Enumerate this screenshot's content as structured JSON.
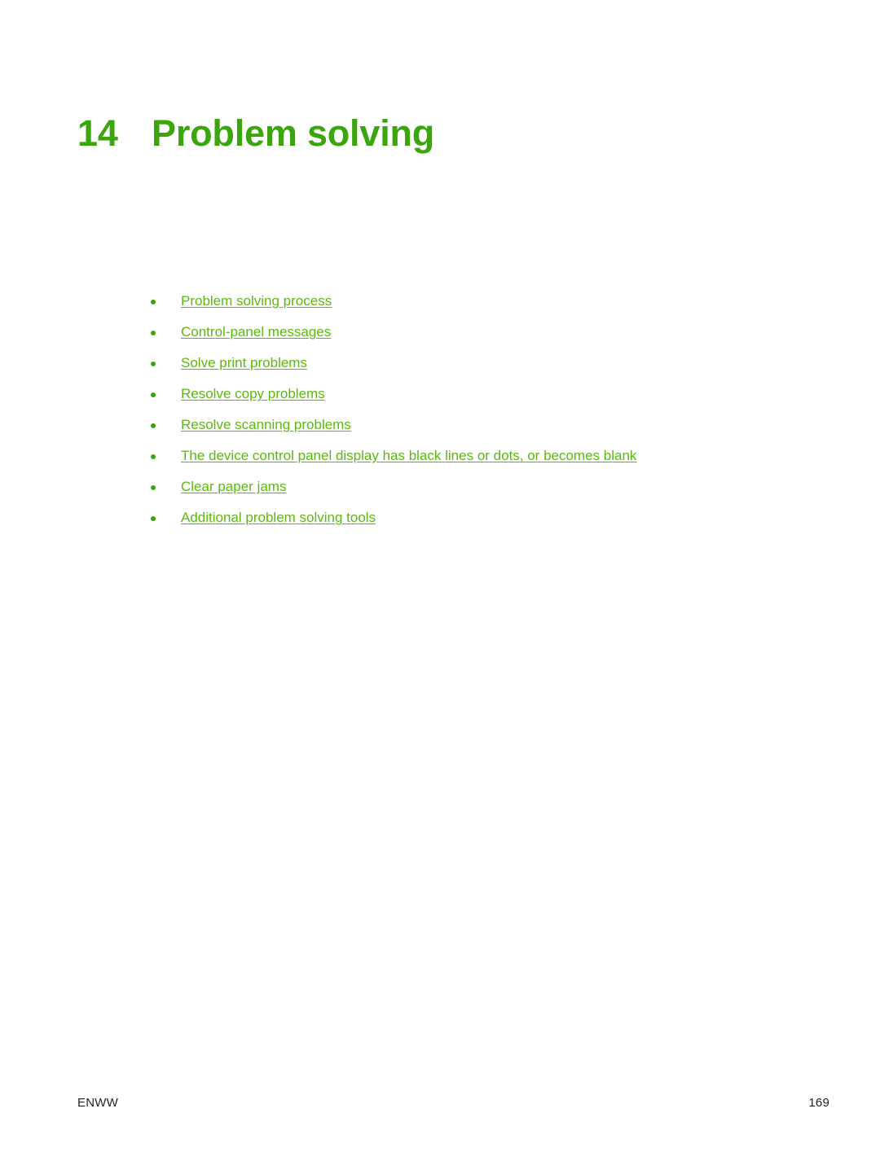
{
  "document": {
    "chapter_number": "14",
    "chapter_title": "Problem solving"
  },
  "section_links": [
    {
      "label": "Problem solving process"
    },
    {
      "label": "Control-panel messages"
    },
    {
      "label": "Solve print problems"
    },
    {
      "label": "Resolve copy problems"
    },
    {
      "label": "Resolve scanning problems"
    },
    {
      "label": "The device control panel display has black lines or dots, or becomes blank"
    },
    {
      "label": "Clear paper jams"
    },
    {
      "label": "Additional problem solving tools"
    }
  ],
  "footer": {
    "left": "ENWW",
    "page_number": "169"
  },
  "colors": {
    "heading_green": "#3aa50d",
    "link_green": "#5bb80f",
    "footer_text": "#231f20",
    "page_background": "#ffffff"
  }
}
